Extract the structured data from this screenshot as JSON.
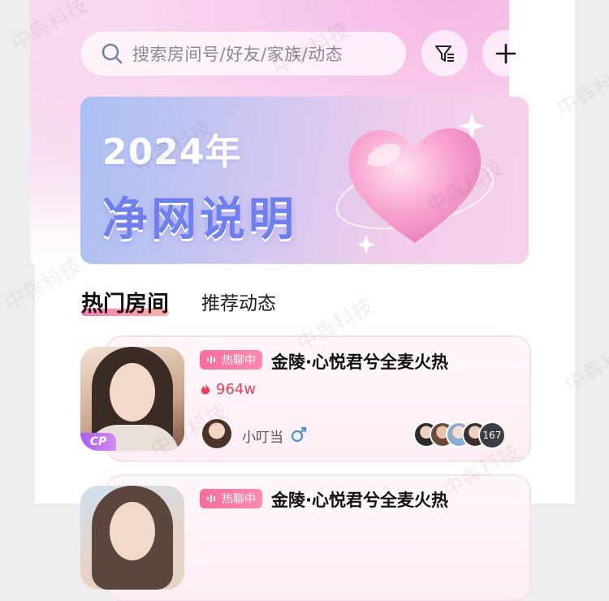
{
  "search": {
    "placeholder": "搜索房间号/好友/家族/动态"
  },
  "banner": {
    "year": "2024年",
    "title": "净网说明"
  },
  "tabs": [
    {
      "label": "热门房间",
      "active": true
    },
    {
      "label": "推荐动态",
      "active": false
    }
  ],
  "rooms": [
    {
      "badge": "热聊中",
      "title": "金陵·心悦君兮全麦火热",
      "heat": "964w",
      "host": "小叮当",
      "host_gender": "male",
      "member_count": "167",
      "tag": "CP"
    },
    {
      "badge": "热聊中",
      "title": "金陵·心悦君兮全麦火热"
    }
  ],
  "watermark": "中犇科技",
  "colors": {
    "accent_pink": "#ff6b9c",
    "heat_red": "#f23c53",
    "gender_blue": "#4a90e2",
    "cp_purple": "#a55cf0"
  }
}
